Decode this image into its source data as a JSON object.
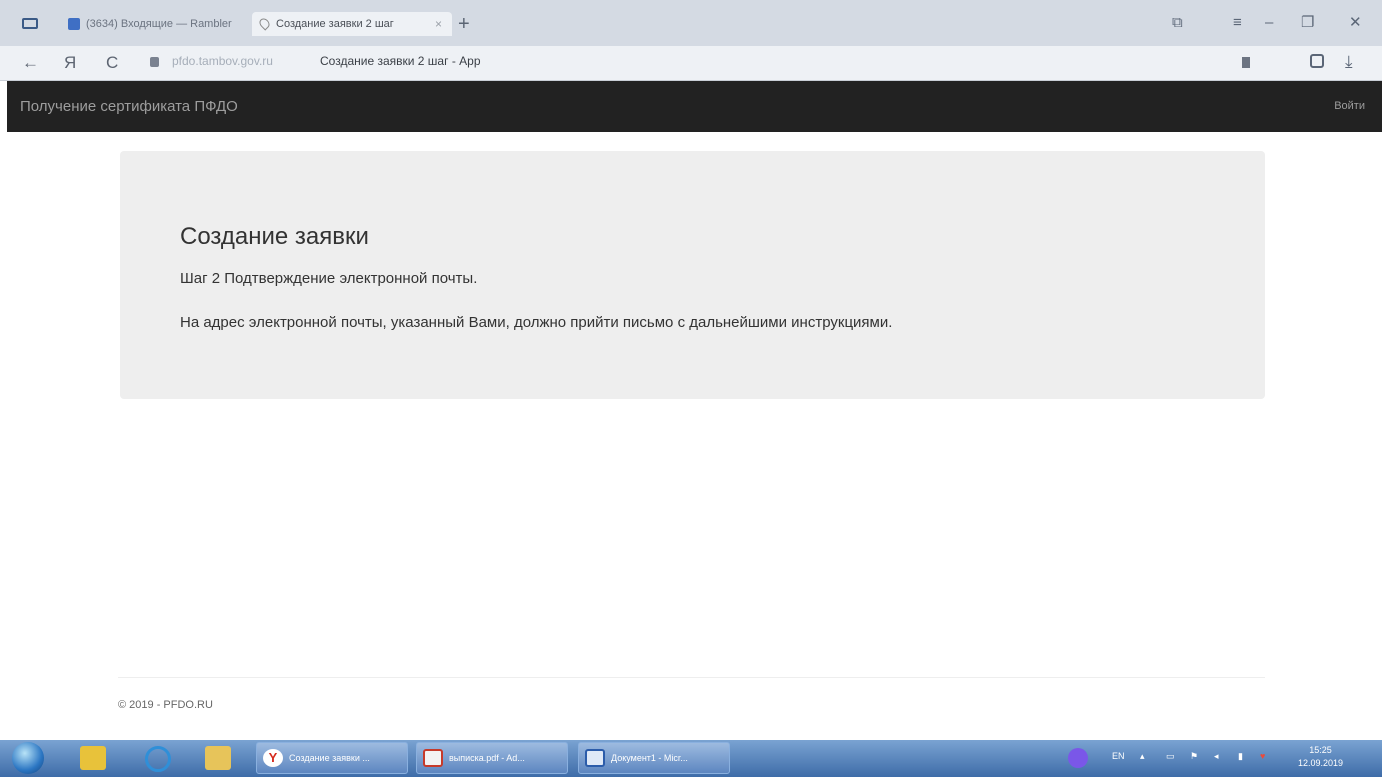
{
  "browser": {
    "tabs": [
      {
        "title": "(3634) Входящие — Rambler",
        "active": false
      },
      {
        "title": "Создание заявки 2 шаг",
        "active": true
      }
    ],
    "new_tab_glyph": "+",
    "close_tab_glyph": "×",
    "window_controls": [
      "⧉",
      "≡",
      "–",
      "❐",
      "✕"
    ],
    "nav": {
      "back_glyph": "←",
      "yandex_glyph": "Я",
      "reload_glyph": "C"
    },
    "address": {
      "host": "pfdo.tambov.gov.ru",
      "page_title": "Создание заявки 2 шаг - App"
    },
    "download_glyph": "⤓"
  },
  "site": {
    "brand": "Получение сертификата ПФДО",
    "login_label": "Войти"
  },
  "main": {
    "title": "Создание заявки",
    "step_text": "Шаг 2 Подтверждение электронной почты.",
    "info_text": "На адрес электронной почты, указанный Вами, должно прийти письмо с дальнейшими инструкциями."
  },
  "footer": {
    "copyright": "© 2019 - PFDO.RU"
  },
  "taskbar": {
    "buttons": [
      {
        "label": "Создание заявки ...",
        "icon": "yandex-browser-icon"
      },
      {
        "label": "выписка.pdf - Ad...",
        "icon": "pdf-icon"
      },
      {
        "label": "Документ1 - Micr...",
        "icon": "word-icon"
      }
    ],
    "language": "EN",
    "time": "15:25",
    "date": "12.09.2019"
  },
  "colors": {
    "navbar_bg": "#222222",
    "navbar_text": "#9d9d9d",
    "jumbotron_bg": "#eeeeee",
    "taskbar_bg": "#4a78b4"
  }
}
